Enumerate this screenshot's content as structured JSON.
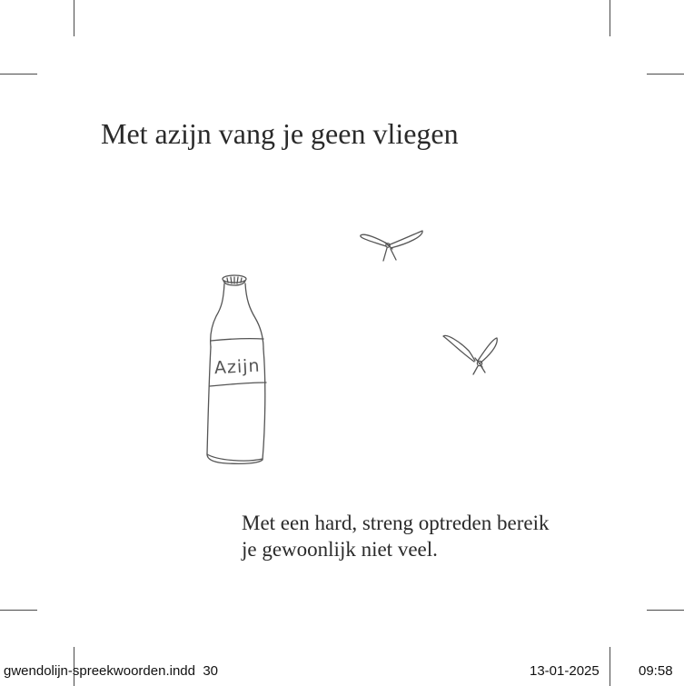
{
  "page": {
    "title": "Met azijn vang je geen vliegen",
    "caption_lines": [
      "Met een hard, streng optreden bereik",
      "je gewoonlijk niet veel."
    ],
    "bottle_label": "Azijn"
  },
  "slug": {
    "filename": "gwendolijn-spreekwoorden.indd",
    "page_number": "30",
    "date": "13-01-2025",
    "time": "09:58"
  },
  "colors": {
    "ink": "#2a2a2a",
    "pencil": "#555555",
    "crop_marks": "#4a4a4a"
  }
}
